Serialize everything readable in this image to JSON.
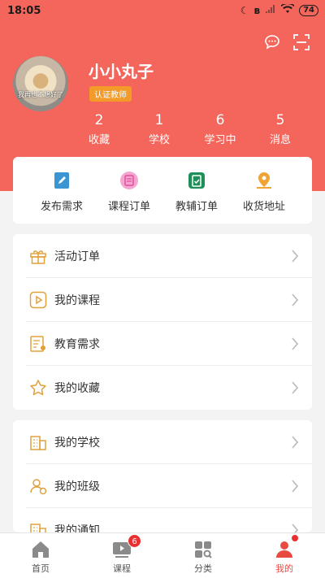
{
  "status_bar": {
    "time": "18:05",
    "battery": "74"
  },
  "profile": {
    "name": "小小丸子",
    "badge": "认证教师",
    "avatar_caption": "我再也不想好了"
  },
  "stats": [
    {
      "value": "2",
      "label": "收藏"
    },
    {
      "value": "1",
      "label": "学校"
    },
    {
      "value": "6",
      "label": "学习中"
    },
    {
      "value": "5",
      "label": "消息"
    }
  ],
  "quick_actions": [
    {
      "label": "发布需求",
      "icon": "edit-document-icon",
      "color": "#3a95d2"
    },
    {
      "label": "课程订单",
      "icon": "course-order-icon",
      "color": "#e56db2"
    },
    {
      "label": "教辅订单",
      "icon": "clipboard-order-icon",
      "color": "#1f8f5a"
    },
    {
      "label": "收货地址",
      "icon": "map-pin-icon",
      "color": "#f0a436"
    }
  ],
  "menu_group1": [
    {
      "label": "活动订单",
      "icon": "gift-icon"
    },
    {
      "label": "我的课程",
      "icon": "play-icon"
    },
    {
      "label": "教育需求",
      "icon": "requirement-icon"
    },
    {
      "label": "我的收藏",
      "icon": "star-icon"
    }
  ],
  "menu_group2": [
    {
      "label": "我的学校",
      "icon": "building-icon"
    },
    {
      "label": "我的班级",
      "icon": "class-group-icon"
    },
    {
      "label": "我的通知",
      "icon": "notice-icon"
    }
  ],
  "tabbar": {
    "tabs": [
      {
        "label": "首页",
        "icon": "home-icon"
      },
      {
        "label": "课程",
        "icon": "video-course-icon"
      },
      {
        "label": "分类",
        "icon": "category-icon"
      },
      {
        "label": "我的",
        "icon": "profile-icon"
      }
    ],
    "course_badge": "6",
    "active_tab": "我的"
  },
  "colors": {
    "header": "#f4665b",
    "accent_icon": "#e0a13b",
    "badge": "#f39a28",
    "active": "#e84a41"
  }
}
